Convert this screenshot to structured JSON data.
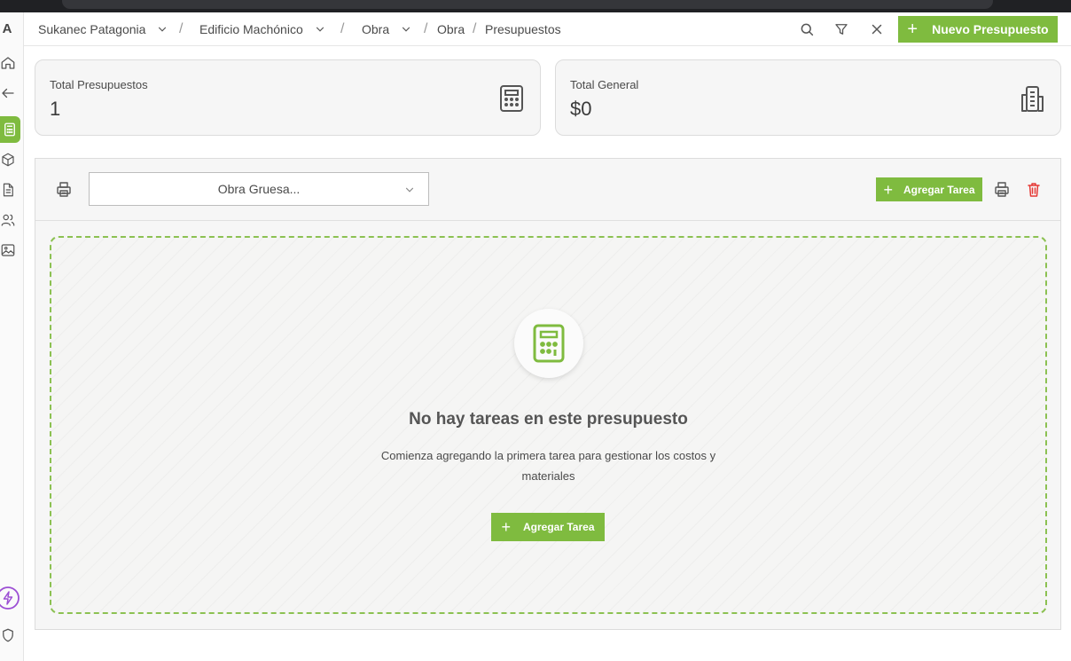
{
  "sidebar": {
    "logo": "A",
    "icons": [
      "home-icon",
      "back-arrow-icon",
      "calculator-icon",
      "box-icon",
      "document-icon",
      "users-icon",
      "image-icon",
      "lightning-icon",
      "shield-icon"
    ]
  },
  "breadcrumb": {
    "company": "Sukanec Patagonia",
    "building": "Edificio Machónico",
    "project": "Obra",
    "section": "Obra",
    "page": "Presupuestos",
    "separator": "/"
  },
  "header": {
    "new_budget_label": "Nuevo Presupuesto"
  },
  "stats": {
    "total_budgets_label": "Total Presupuestos",
    "total_budgets_value": "1",
    "total_general_label": "Total General",
    "total_general_value": "$0"
  },
  "budget": {
    "selected": "Obra Gruesa...",
    "add_task_label": "Agregar Tarea"
  },
  "empty_state": {
    "title": "No hay tareas en este presupuesto",
    "description": "Comienza agregando la primera tarea para gestionar los costos y materiales",
    "button_label": "Agregar Tarea"
  },
  "colors": {
    "accent": "#7fbb3f",
    "danger": "#e53935"
  }
}
